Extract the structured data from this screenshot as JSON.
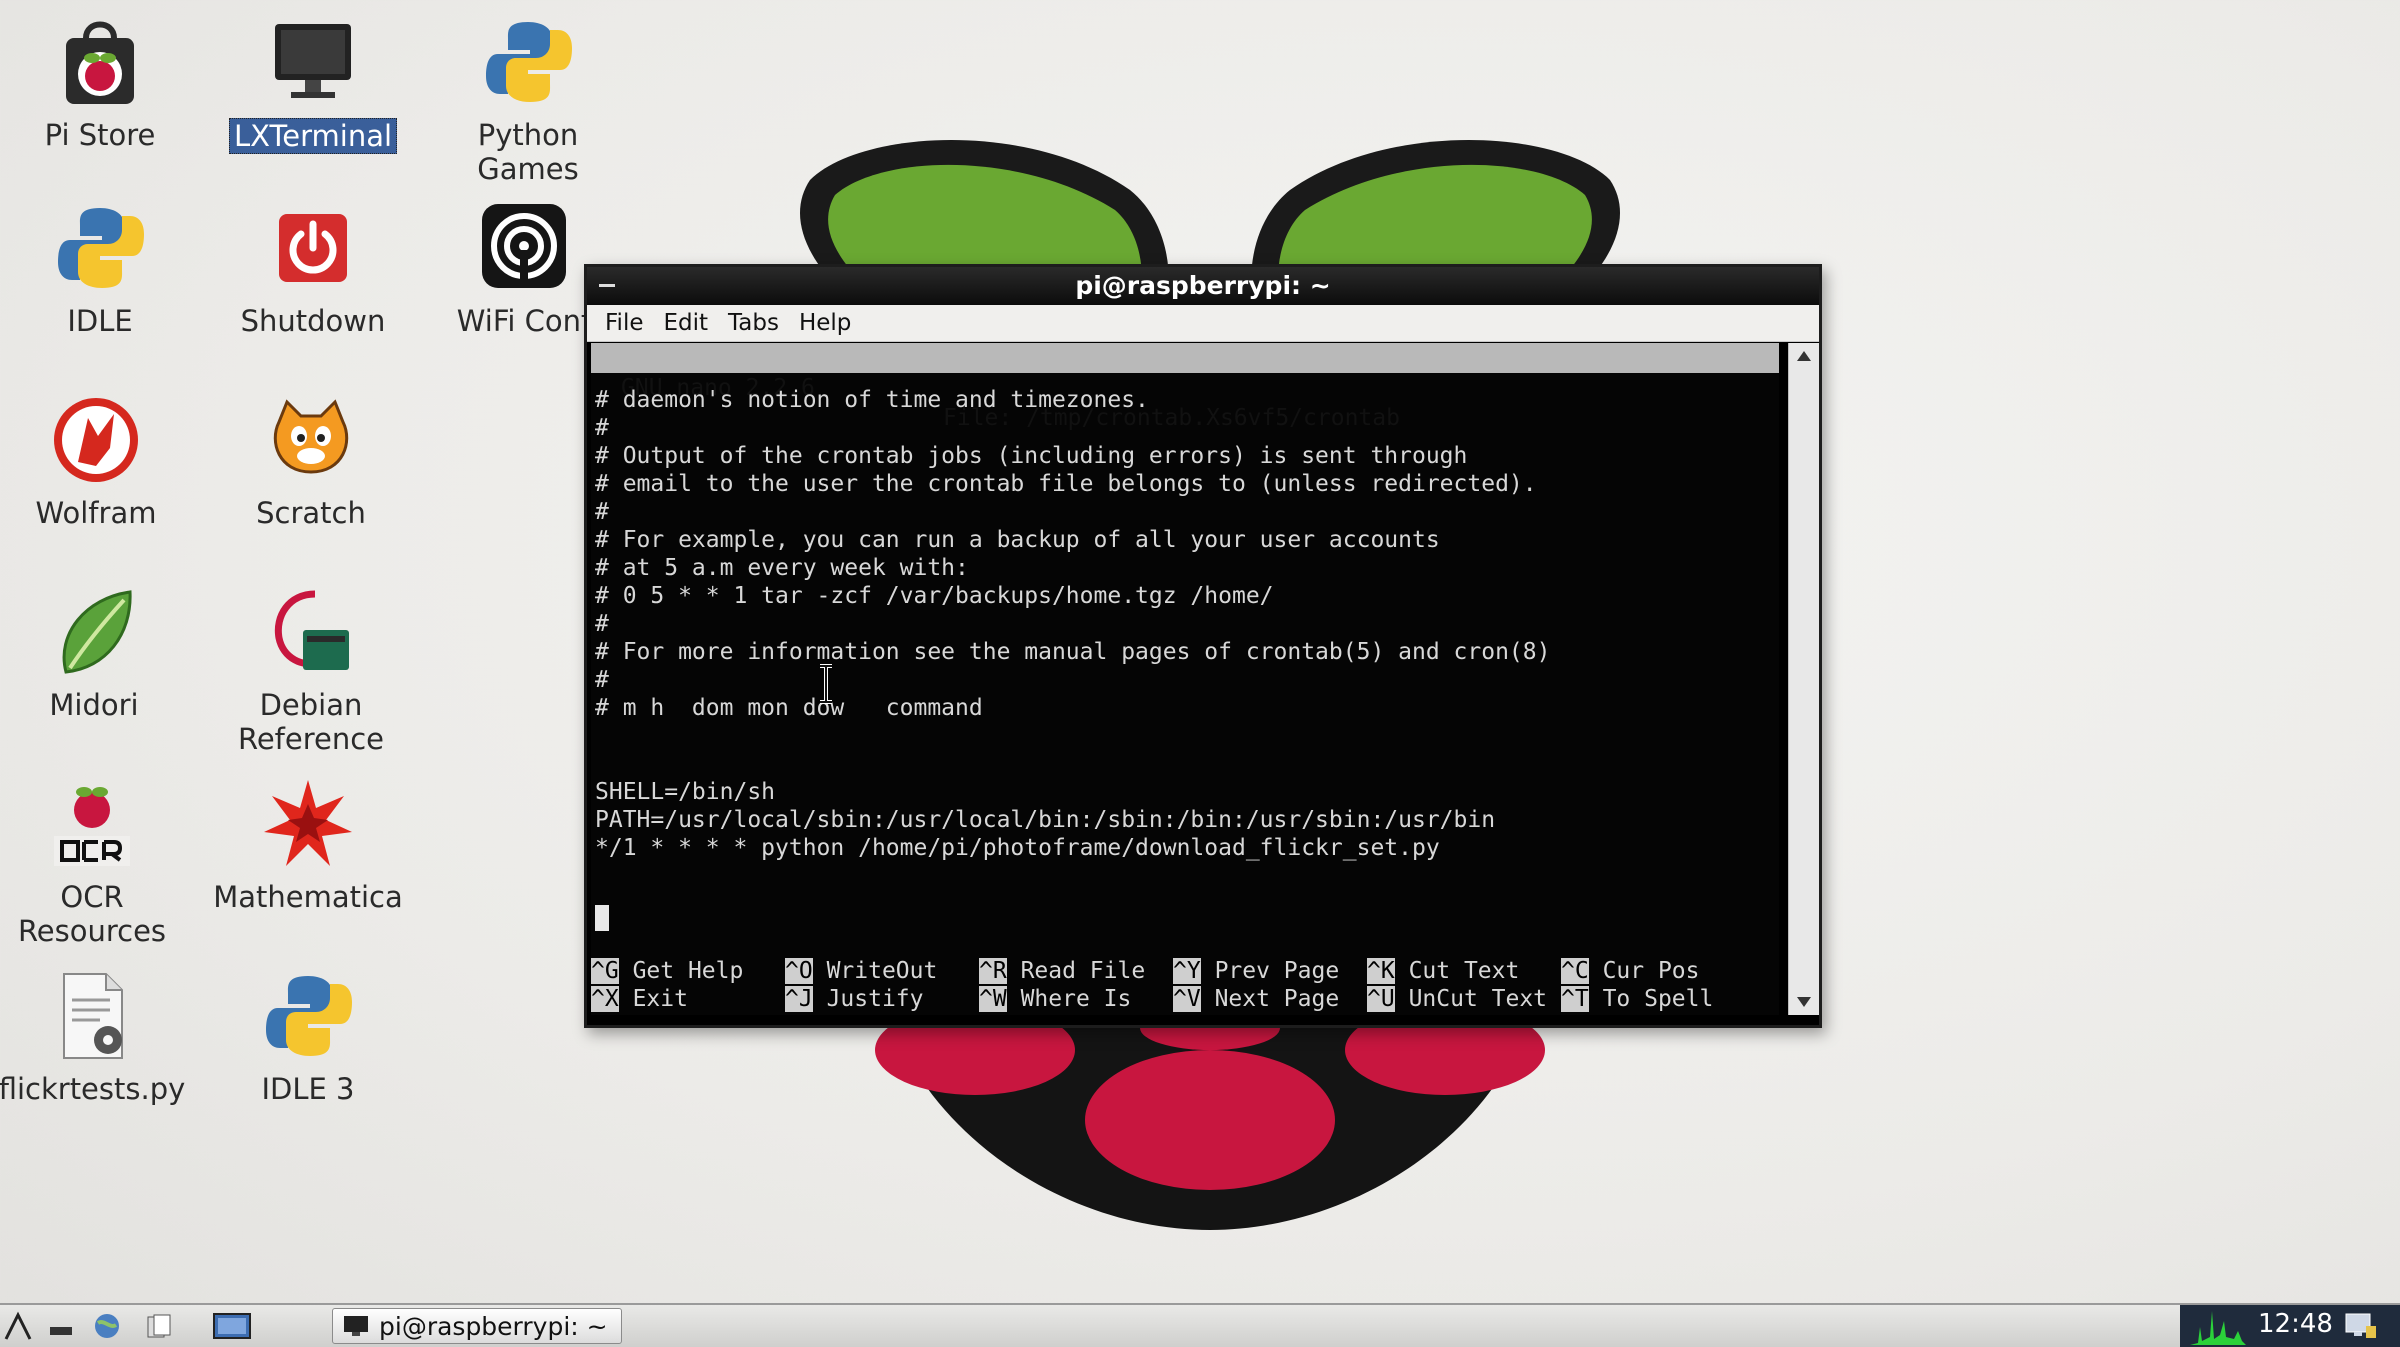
{
  "desktop": {
    "icons": [
      {
        "label": "Pi Store",
        "icon": "pi-store-icon"
      },
      {
        "label": "LXTerminal",
        "icon": "terminal-icon",
        "selected": true
      },
      {
        "label": "Python",
        "label2": "Games",
        "icon": "python-icon"
      },
      {
        "label": "IDLE",
        "icon": "python-icon"
      },
      {
        "label": "Shutdown",
        "icon": "power-icon"
      },
      {
        "label": "WiFi Conf",
        "icon": "wifi-icon"
      },
      {
        "label": "Wolfram",
        "icon": "wolfram-icon"
      },
      {
        "label": "Scratch",
        "icon": "scratch-cat-icon"
      },
      {
        "label": "Midori",
        "icon": "midori-leaf-icon"
      },
      {
        "label": "Debian",
        "label2": "Reference",
        "icon": "debian-book-icon"
      },
      {
        "label": "OCR",
        "label2": "Resources",
        "icon": "ocr-icon"
      },
      {
        "label": "Mathematica",
        "icon": "mathematica-star-icon"
      },
      {
        "label": "flickrtests.py",
        "icon": "python-script-icon"
      },
      {
        "label": "IDLE 3",
        "icon": "python-icon"
      }
    ]
  },
  "terminal": {
    "title": "pi@raspberrypi: ~",
    "menu": [
      "File",
      "Edit",
      "Tabs",
      "Help"
    ],
    "nano_version": "GNU nano 2.2.6",
    "nano_file": "File: /tmp/crontab.Xs6vf5/crontab",
    "lines": [
      "# daemon's notion of time and timezones.",
      "#",
      "# Output of the crontab jobs (including errors) is sent through",
      "# email to the user the crontab file belongs to (unless redirected).",
      "#",
      "# For example, you can run a backup of all your user accounts",
      "# at 5 a.m every week with:",
      "# 0 5 * * 1 tar -zcf /var/backups/home.tgz /home/",
      "#",
      "# For more information see the manual pages of crontab(5) and cron(8)",
      "#",
      "# m h  dom mon dow   command",
      "",
      "",
      "SHELL=/bin/sh",
      "PATH=/usr/local/sbin:/usr/local/bin:/sbin:/bin:/usr/sbin:/usr/bin",
      "*/1 * * * * python /home/pi/photoframe/download_flickr_set.py"
    ],
    "shortcuts": [
      [
        {
          "key": "^G",
          "label": "Get Help"
        },
        {
          "key": "^O",
          "label": "WriteOut"
        },
        {
          "key": "^R",
          "label": "Read File"
        },
        {
          "key": "^Y",
          "label": "Prev Page"
        },
        {
          "key": "^K",
          "label": "Cut Text"
        },
        {
          "key": "^C",
          "label": "Cur Pos"
        }
      ],
      [
        {
          "key": "^X",
          "label": "Exit"
        },
        {
          "key": "^J",
          "label": "Justify"
        },
        {
          "key": "^W",
          "label": "Where Is"
        },
        {
          "key": "^V",
          "label": "Next Page"
        },
        {
          "key": "^U",
          "label": "UnCut Text"
        },
        {
          "key": "^T",
          "label": "To Spell"
        }
      ]
    ]
  },
  "taskbar": {
    "task_label": "pi@raspberrypi: ~",
    "clock": "12:48"
  }
}
